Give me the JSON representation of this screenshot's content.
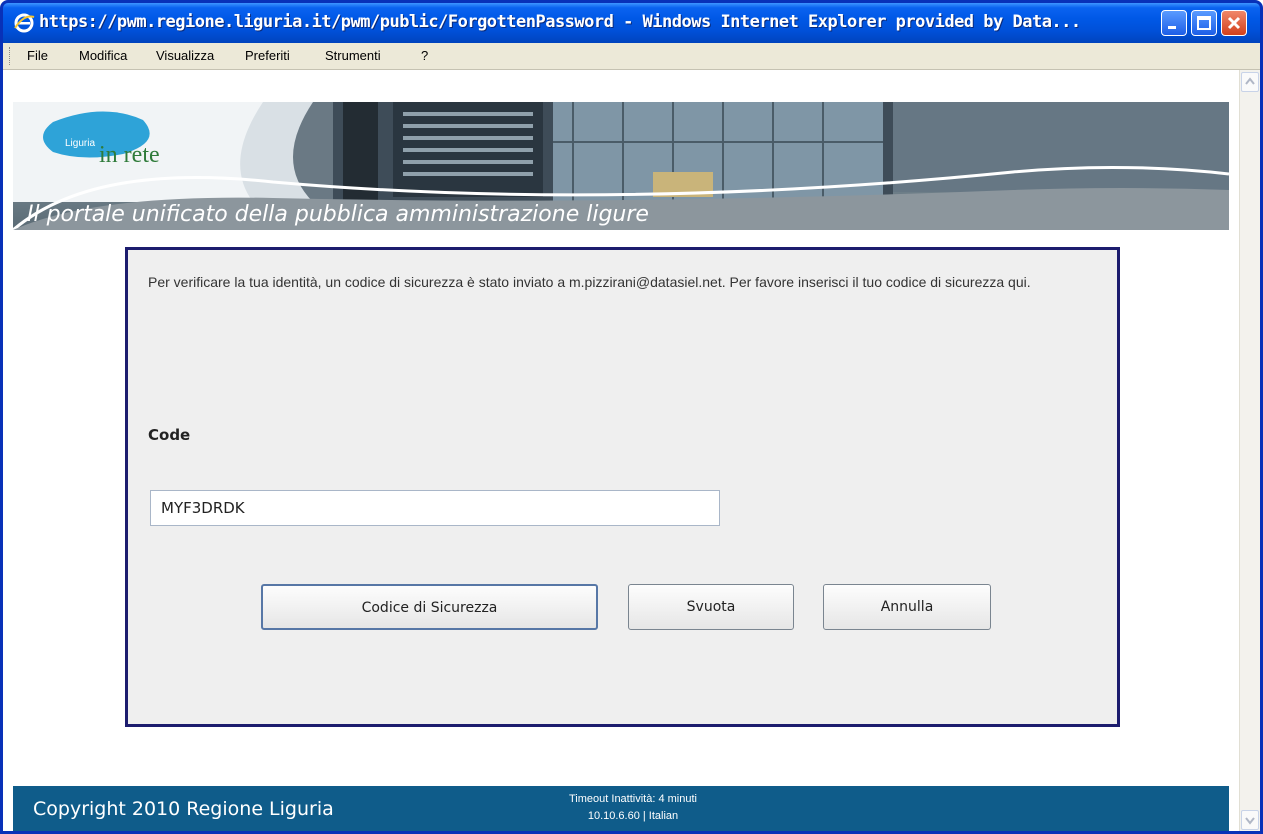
{
  "window": {
    "title": "https://pwm.regione.liguria.it/pwm/public/ForgottenPassword - Windows Internet Explorer provided by Data..."
  },
  "menu": {
    "items": [
      "File",
      "Modifica",
      "Visualizza",
      "Preferiti",
      "Strumenti",
      "?"
    ]
  },
  "banner": {
    "logo_small": "Liguria",
    "logo_main": "in rete",
    "slogan": "Il portale unificato della pubblica amministrazione ligure"
  },
  "form": {
    "message": "Per verificare la tua identità, un codice di sicurezza è stato inviato a m.pizzirani@datasiel.net. Per favore inserisci il tuo codice di sicurezza qui.",
    "code_label": "Code",
    "code_value": "MYF3DRDK",
    "buttons": {
      "submit": "Codice di Sicurezza",
      "reset": "Svuota",
      "cancel": "Annulla"
    }
  },
  "footer": {
    "copyright": "Copyright 2010 Regione Liguria",
    "timeout": "Timeout Inattività: 4 minuti",
    "server": "10.10.6.60 | Italian"
  },
  "colors": {
    "titlebar": "#0058e6",
    "panel_border": "#1c1c6e",
    "footer": "#0f5c8a",
    "logo_swoosh": "#2ea3d8"
  },
  "icons": {
    "browser": "ie-logo-icon",
    "minimize": "minimize-icon",
    "maximize": "maximize-icon",
    "close": "close-icon",
    "scroll_up": "scroll-up-arrow-icon",
    "scroll_down": "scroll-down-arrow-icon"
  }
}
